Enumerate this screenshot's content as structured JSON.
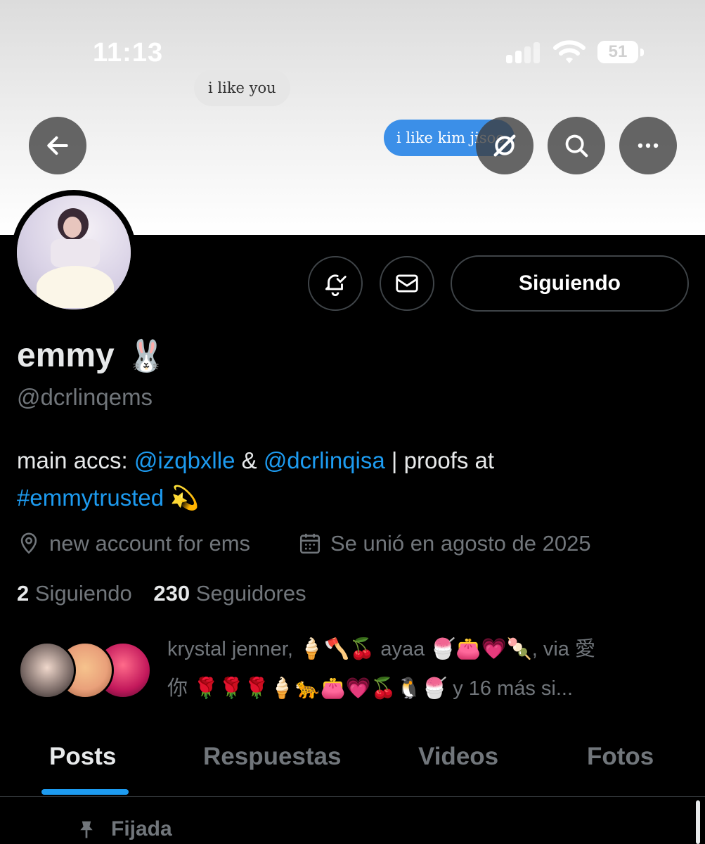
{
  "status_bar": {
    "time": "11:13",
    "battery": "51"
  },
  "banner": {
    "bubble_grey": "i like you",
    "bubble_blue": "i like kim jisoo"
  },
  "top_actions": [
    "back",
    "grok",
    "search",
    "more"
  ],
  "profile": {
    "name": "emmy",
    "name_emoji": "🐰",
    "handle": "@dcrlinqems",
    "follow_button": "Siguiendo",
    "bio": {
      "prefix": "main accs: ",
      "mention1": "@izqbxlle",
      "amp": " & ",
      "mention2": "@dcrlinqisa",
      "middle": " | proofs at",
      "hashtag": "#emmytrusted",
      "suffix": " 💫"
    },
    "location": "new account for ems",
    "joined": "Se unió en agosto de 2025",
    "following_count": "2",
    "following_label": "Siguiendo",
    "followers_count": "230",
    "followers_label": "Seguidores",
    "followed_by_line1": "krystal jenner, 🍦🪓🍒 ayaa 🍧👛💗🍡, via 愛",
    "followed_by_line2": "你 🌹🌹🌹🍦🐆👛💗🍒🐧🍧 y 16 más si..."
  },
  "tabs": [
    {
      "label": "Posts",
      "active": true
    },
    {
      "label": "Respuestas",
      "active": false
    },
    {
      "label": "Videos",
      "active": false
    },
    {
      "label": "Fotos",
      "active": false
    }
  ],
  "pinned_label": "Fijada",
  "colors": {
    "accent": "#1d9bf0",
    "muted": "#71767b",
    "text": "#e7e9ea",
    "background": "#000000"
  }
}
